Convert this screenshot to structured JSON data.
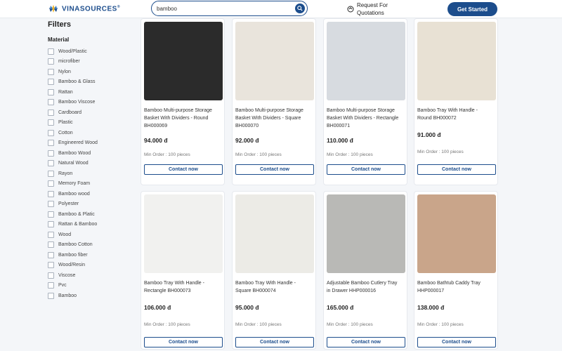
{
  "header": {
    "logo_text": "VINASOURCES",
    "logo_mark": "®",
    "search_value": "bamboo",
    "rfq_line1": "Request For",
    "rfq_line2": "Quotations",
    "get_started": "Get Started"
  },
  "sidebar": {
    "title": "Filters",
    "material_title": "Material",
    "materials": [
      "Wood/Plastic",
      "microfiber",
      "Nylon",
      "Bamboo & Glass",
      "Rattan",
      "Bamboo Viscose",
      "Cardboard",
      "Plastic",
      "Cotton",
      "Engineered Wood",
      "Bamboo Wood",
      "Natural Wood",
      "Rayon",
      "Memory Foam",
      "Bamboo wood",
      "Polyester",
      "Bamboo & Platic",
      "Rattan & Bamboo",
      "Wood",
      "Bamboo Cotton",
      "Bamboo fiber",
      "Wood/Resin",
      "Viscose",
      "Pvc",
      "Bamboo"
    ]
  },
  "products": [
    {
      "title_lines": [
        "Bamboo Multi-purpose Storage",
        "Basket With Dividers - Round",
        "BH000069"
      ],
      "price": "94.000 đ",
      "min_order": "Min Order : 100 pieces",
      "cta": "Contact now",
      "image": "round-basket-photo"
    },
    {
      "title_lines": [
        "Bamboo Multi-purpose Storage",
        "Basket With Dividers - Square",
        "BH000070"
      ],
      "price": "92.000 đ",
      "min_order": "Min Order : 100 pieces",
      "cta": "Contact now",
      "image": "square-basket-photo"
    },
    {
      "title_lines": [
        "Bamboo Multi-purpose Storage",
        "Basket With Dividers - Rectangle",
        "BH000071"
      ],
      "price": "110.000 đ",
      "min_order": "Min Order : 100 pieces",
      "cta": "Contact now",
      "image": "rectangle-basket-photo"
    },
    {
      "title_lines": [
        "Bamboo Tray With Handle -",
        "Round BH000072"
      ],
      "price": "91.000 đ",
      "min_order": "Min Order : 100 pieces",
      "cta": "Contact now",
      "image": "round-tray-photo"
    },
    {
      "title_lines": [
        "Bamboo Tray With Handle -",
        "Rectangle BH000073"
      ],
      "price": "106.000 đ",
      "min_order": "Min Order : 100 pieces",
      "cta": "Contact now",
      "image": "rectangle-tray-photo"
    },
    {
      "title_lines": [
        "Bamboo Tray With Handle -",
        "Square BH000074"
      ],
      "price": "95.000 đ",
      "min_order": "Min Order : 100 pieces",
      "cta": "Contact now",
      "image": "square-tray-photo"
    },
    {
      "title_lines": [
        "Adjustable Bamboo Cutlery Tray",
        "in Drawer HHP000016"
      ],
      "price": "165.000 đ",
      "min_order": "Min Order : 100 pieces",
      "cta": "Contact now",
      "image": "cutlery-tray-photo"
    },
    {
      "title_lines": [
        "Bamboo Bathtub Caddy Tray",
        "HHP000017"
      ],
      "price": "138.000 đ",
      "min_order": "Min Order : 100 pieces",
      "cta": "Contact now",
      "image": "bathtub-caddy-photo"
    }
  ],
  "colors": {
    "brand": "#1c4d8c"
  }
}
